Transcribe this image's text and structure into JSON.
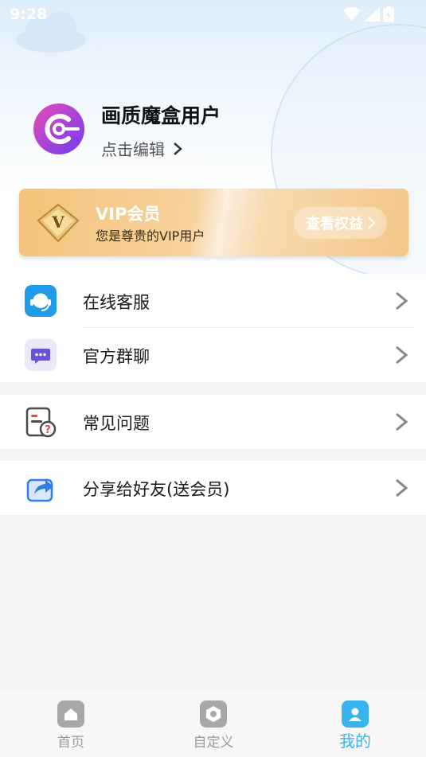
{
  "status_bar": {
    "time": "9:28"
  },
  "profile": {
    "username": "画质魔盒用户",
    "edit_label": "点击编辑"
  },
  "vip": {
    "title": "VIP会员",
    "subtitle": "您是尊贵的VIP用户",
    "button_label": "查看权益",
    "badge_letter": "V"
  },
  "menu_groups": [
    {
      "items": [
        {
          "label": "在线客服",
          "icon": "customer-service-icon"
        },
        {
          "label": "官方群聊",
          "icon": "chat-bubble-icon"
        }
      ]
    },
    {
      "items": [
        {
          "label": "常见问题",
          "icon": "faq-document-icon"
        }
      ]
    },
    {
      "items": [
        {
          "label": "分享给好友(送会员)",
          "icon": "share-icon"
        }
      ]
    }
  ],
  "tabbar": {
    "tabs": [
      {
        "label": "首页",
        "icon": "home-icon",
        "active": false
      },
      {
        "label": "自定义",
        "icon": "custom-hexagon-icon",
        "active": false
      },
      {
        "label": "我的",
        "icon": "profile-icon",
        "active": true
      }
    ]
  },
  "colors": {
    "accent": "#3ab4f0",
    "vip_gold": "#f3c27a",
    "avatar_purple": "#7b3ff2",
    "avatar_pink": "#e84bb8"
  }
}
